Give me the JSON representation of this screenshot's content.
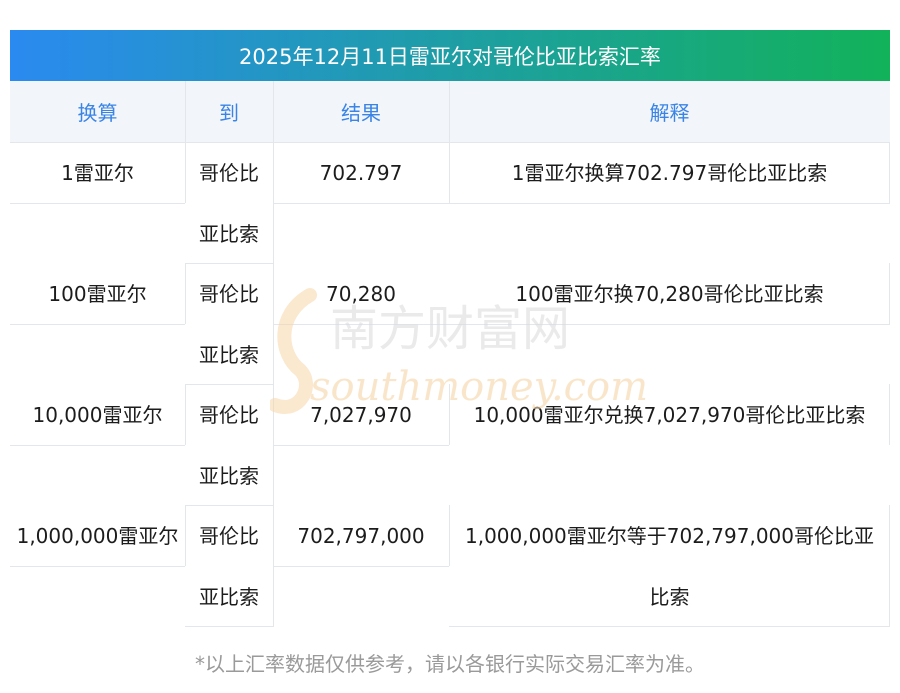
{
  "title": "2025年12月11日雷亚尔对哥伦比亚比索汇率",
  "headers": [
    "换算",
    "到",
    "结果",
    "解释"
  ],
  "rows": [
    {
      "amount": "1雷亚尔",
      "to_line1": "哥伦比",
      "to_line2": "亚比索",
      "result": "702.797",
      "explain_line1": "1雷亚尔换算702.797哥伦比亚比索",
      "explain_line2": ""
    },
    {
      "amount": "100雷亚尔",
      "to_line1": "哥伦比",
      "to_line2": "亚比索",
      "result": "70,280",
      "explain_line1": "100雷亚尔换70,280哥伦比亚比索",
      "explain_line2": ""
    },
    {
      "amount": "10,000雷亚尔",
      "to_line1": "哥伦比",
      "to_line2": "亚比索",
      "result": "7,027,970",
      "explain_line1": "10,000雷亚尔兑换7,027,970哥伦比亚比索",
      "explain_line2": ""
    },
    {
      "amount": "1,000,000雷亚尔",
      "to_line1": "哥伦比",
      "to_line2": "亚比索",
      "result": "702,797,000",
      "explain_line1": "1,000,000雷亚尔等于702,797,000哥伦比亚",
      "explain_line2": "比索"
    }
  ],
  "footnote": "*以上汇率数据仅供参考，请以各银行实际交易汇率为准。",
  "watermark": {
    "logo_text": "南方财富网",
    "logo_sub": "southmoney.com"
  },
  "colors": {
    "title_gradient_start": "#2a8af0",
    "title_gradient_end": "#12b25a",
    "header_text": "#3a84e5",
    "header_bg": "#f2f6fb"
  }
}
